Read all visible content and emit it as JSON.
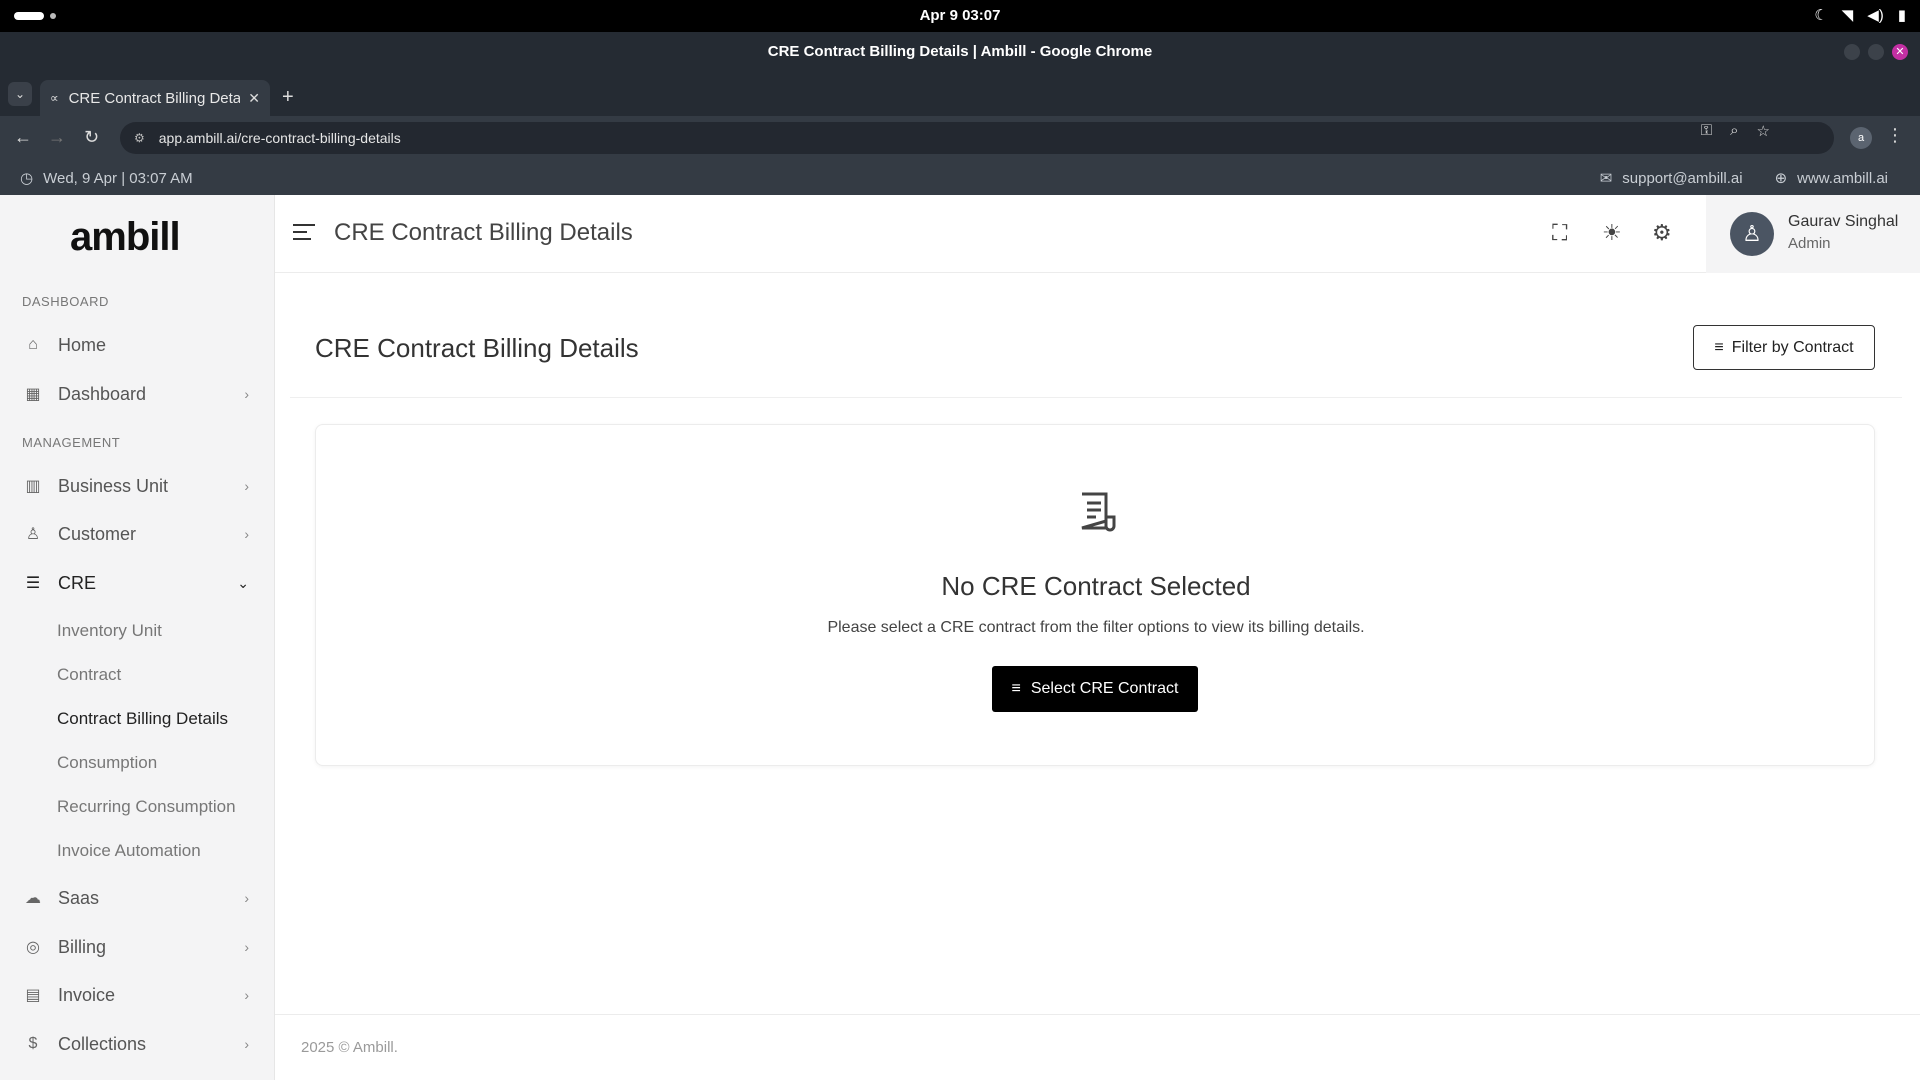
{
  "os": {
    "clock": "Apr 9  03:07",
    "tray_icons": [
      "moon-icon",
      "wifi-icon",
      "volume-icon",
      "battery-icon"
    ]
  },
  "browser": {
    "window_title": "CRE Contract Billing Details | Ambill - Google Chrome",
    "tab_title": "CRE Contract Billing Details | Ambill",
    "url": "app.ambill.ai/cre-contract-billing-details",
    "profile_initial": "a"
  },
  "info_bar": {
    "datetime": "Wed, 9 Apr | 03:07 AM",
    "support_email": "support@ambill.ai",
    "website": "www.ambill.ai"
  },
  "sidebar": {
    "logo": "ambill",
    "sections": {
      "dashboard": "DASHBOARD",
      "management": "MANAGEMENT"
    },
    "items": {
      "home": "Home",
      "dashboard": "Dashboard",
      "business_unit": "Business Unit",
      "customer": "Customer",
      "cre": "CRE",
      "saas": "Saas",
      "billing": "Billing",
      "invoice": "Invoice",
      "collections": "Collections"
    },
    "cre_sub": {
      "inventory_unit": "Inventory Unit",
      "contract": "Contract",
      "contract_billing_details": "Contract Billing Details",
      "consumption": "Consumption",
      "recurring_consumption": "Recurring Consumption",
      "invoice_automation": "Invoice Automation"
    },
    "active_sub": "contract_billing_details"
  },
  "header": {
    "title": "CRE Contract Billing Details",
    "user_name": "Gaurav Singhal",
    "user_role": "Admin"
  },
  "main": {
    "title": "CRE Contract Billing Details",
    "filter_button": "Filter by Contract",
    "empty_title": "No CRE Contract Selected",
    "empty_message": "Please select a CRE contract from the filter options to view its billing details.",
    "select_button": "Select CRE Contract"
  },
  "footer": {
    "text": "2025 © Ambill."
  }
}
